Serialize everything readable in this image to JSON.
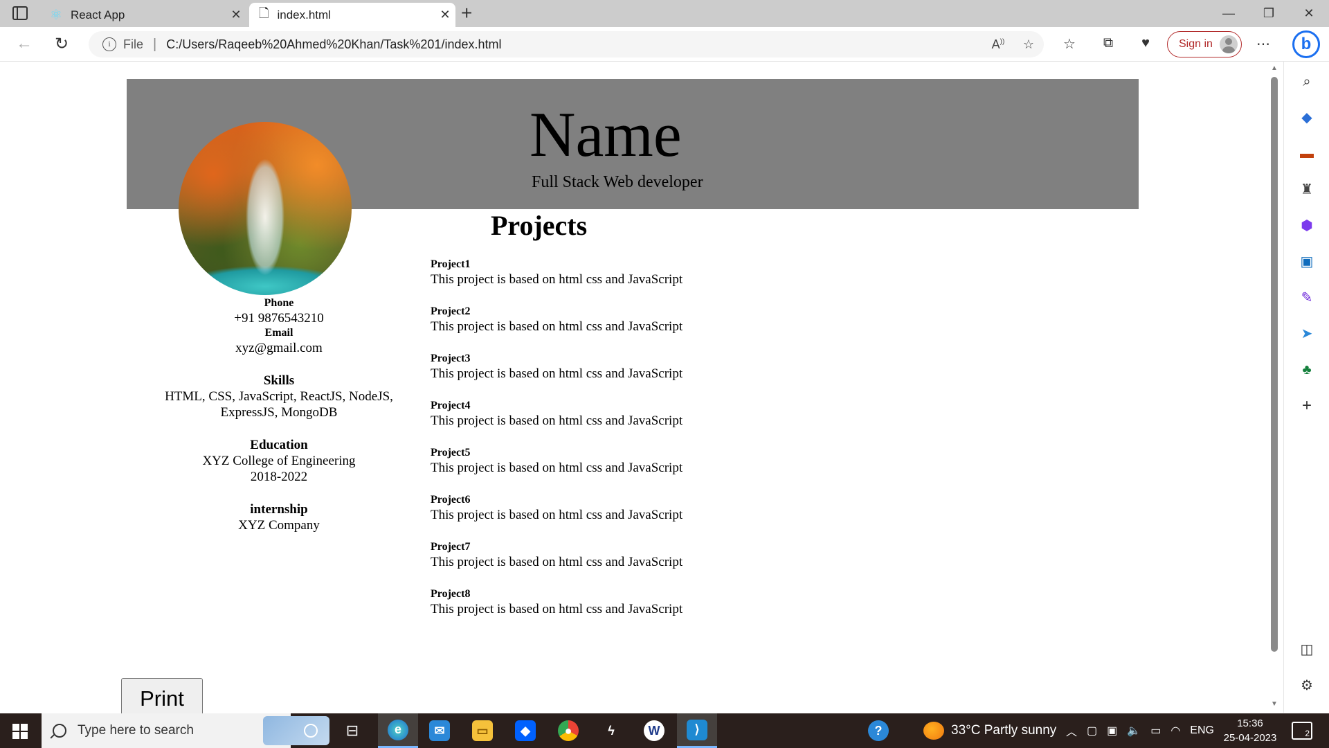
{
  "browser": {
    "tabs": [
      {
        "title": "React App",
        "active": false,
        "icon": "react-icon"
      },
      {
        "title": "index.html",
        "active": true,
        "icon": "file-icon"
      }
    ],
    "address": {
      "scheme_label": "File",
      "url": "C:/Users/Raqeeb%20Ahmed%20Khan/Task%201/index.html"
    },
    "signin_label": "Sign in"
  },
  "resume": {
    "name": "Name",
    "role": "Full Stack Web developer",
    "phone_label": "Phone",
    "phone": "+91 9876543210",
    "email_label": "Email",
    "email": "xyz@gmail.com",
    "skills_label": "Skills",
    "skills": "HTML, CSS, JavaScript, ReactJS, NodeJS, ExpressJS, MongoDB",
    "education_label": "Education",
    "education_school": "XYZ College of Engineering",
    "education_years": "2018-2022",
    "internship_label": "internship",
    "internship_company": "XYZ Company",
    "projects_title": "Projects",
    "projects": [
      {
        "title": "Project1",
        "desc": "This project is based on html css and JavaScript"
      },
      {
        "title": "Project2",
        "desc": "This project is based on html css and JavaScript"
      },
      {
        "title": "Project3",
        "desc": "This project is based on html css and JavaScript"
      },
      {
        "title": "Project4",
        "desc": "This project is based on html css and JavaScript"
      },
      {
        "title": "Project5",
        "desc": "This project is based on html css and JavaScript"
      },
      {
        "title": "Project6",
        "desc": "This project is based on html css and JavaScript"
      },
      {
        "title": "Project7",
        "desc": "This project is based on html css and JavaScript"
      },
      {
        "title": "Project8",
        "desc": "This project is based on html css and JavaScript"
      }
    ],
    "print_label": "Print",
    "header_color": "#808080"
  },
  "taskbar": {
    "search_placeholder": "Type here to search",
    "weather": "33°C  Partly sunny",
    "language": "ENG",
    "time": "15:36",
    "date": "25-04-2023",
    "notification_count": "2"
  }
}
